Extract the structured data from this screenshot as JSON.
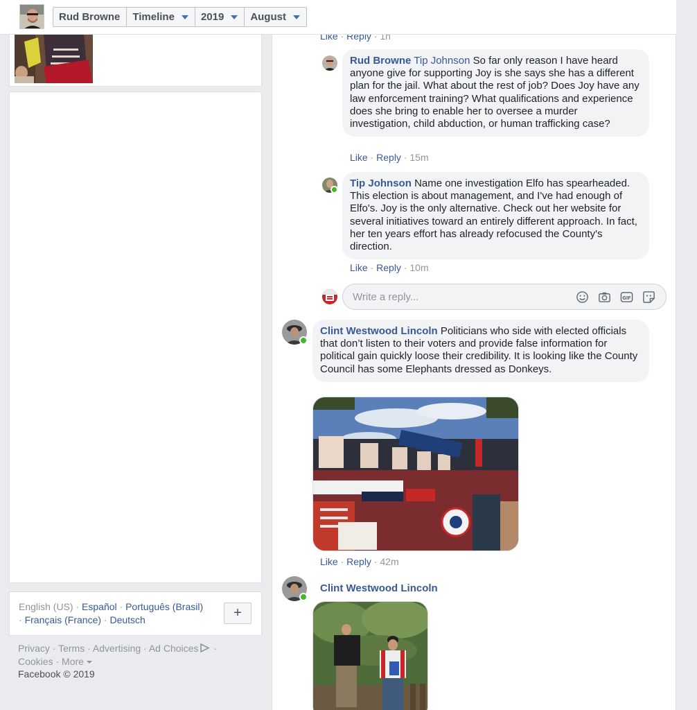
{
  "header": {
    "user_name": "Rud Browne",
    "crumb_section": "Timeline",
    "crumb_year": "2019",
    "crumb_month": "August"
  },
  "languages": {
    "current": "English (US)",
    "options": [
      "Español",
      "Português (Brasil)",
      "Français (France)",
      "Deutsch"
    ],
    "add_label": "+"
  },
  "footer": {
    "links": [
      "Privacy",
      "Terms",
      "Advertising",
      "Ad Choices",
      "Cookies",
      "More"
    ],
    "copyright": "Facebook © 2019"
  },
  "comments": {
    "top_actions": {
      "like": "Like",
      "reply": "Reply",
      "time": "1h"
    },
    "reply_1": {
      "author": "Rud Browne",
      "mention": "Tip Johnson",
      "text": "So far only reason I have heard anyone give for supporting Joy is she says she has a different plan for the jail. What about the rest of job? Does Joy have any law enforcement training? What qualifications and experience does she bring to enable her to oversee a murder investigation, child abduction, or human trafficking case?",
      "like": "Like",
      "reply": "Reply",
      "time": "15m"
    },
    "reply_2": {
      "author": "Tip Johnson",
      "text": "Name one investigation Elfo has spearheaded. This election is about management, and I've had enough of Elfo's. Joy is the only alternative. Check out her website for several initiatives toward an entirely different approach. In fact, her ten years effort has already refocused the County's direction.",
      "like": "Like",
      "reply": "Reply",
      "time": "10m"
    },
    "reply_box": {
      "placeholder": "Write a reply..."
    },
    "comment_3": {
      "author": "Clint Westwood Lincoln",
      "text": "Politicians who side with elected officials that don’t listen to their voters and provide false information for political gain quickly loose their credibility. It is looking like the County Council has some Elephants dressed as Donkeys.",
      "like": "Like",
      "reply": "Reply",
      "time": "42m"
    },
    "comment_4": {
      "author": "Clint Westwood Lincoln"
    }
  },
  "colors": {
    "link": "#385898",
    "online": "#42b72a",
    "bubble": "#f2f3f5",
    "background": "#e9ebee"
  }
}
